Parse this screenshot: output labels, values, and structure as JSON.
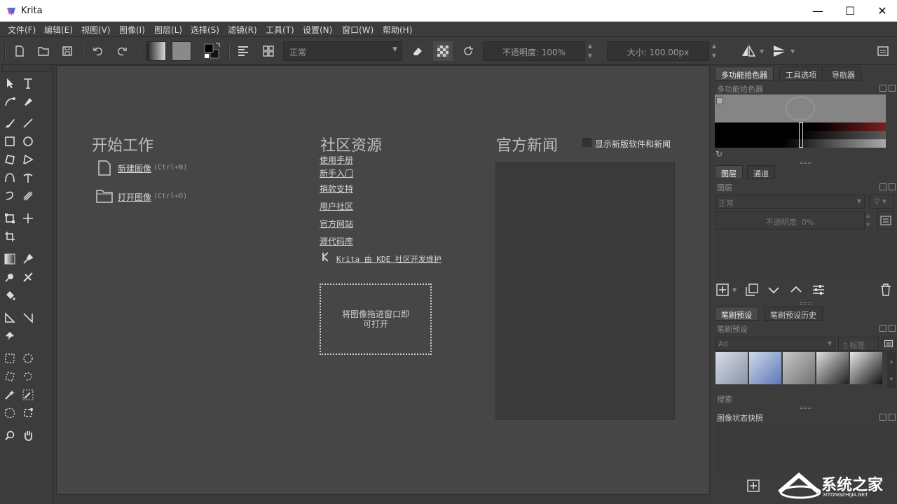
{
  "window": {
    "title": "Krita",
    "minimize": "—",
    "maximize": "☐",
    "close": "✕"
  },
  "menu": [
    "文件(F)",
    "编辑(E)",
    "视图(V)",
    "图像(I)",
    "图层(L)",
    "选择(S)",
    "滤镜(R)",
    "工具(T)",
    "设置(N)",
    "窗口(W)",
    "帮助(H)"
  ],
  "toolbar": {
    "blend_mode": "正常",
    "opacity": "不透明度: 100%",
    "size": "大小: 100.00px"
  },
  "welcome": {
    "start_heading": "开始工作",
    "new_image": "新建图像",
    "new_shortcut": "(Ctrl+N)",
    "open_image": "打开图像",
    "open_shortcut": "(Ctrl+O)",
    "community_heading": "社区资源",
    "links": [
      "使用手册",
      "新手入门",
      "捐款支持",
      "用户社区",
      "官方网站",
      "源代码库"
    ],
    "kde_text": "Krita 由 KDE 社区开发维护",
    "drop_text_line1": "将图像拖进窗口即",
    "drop_text_line2": "可打开",
    "news_heading": "官方新闻",
    "news_checkbox": "显示新版软件和新闻"
  },
  "dock": {
    "top_tabs": [
      "多功能拾色器",
      "工具选项",
      "导航器"
    ],
    "color_title": "多功能拾色器",
    "layer_tabs": [
      "图层",
      "通道"
    ],
    "layers_title": "图层",
    "layer_blend": "正常",
    "layer_opacity": "不透明度:  0%",
    "brush_tabs": [
      "笔刷预设",
      "笔刷预设历史"
    ],
    "brush_title": "笔刷预设",
    "brush_filter": "All",
    "brush_tag": "标签",
    "brush_search": "搜索",
    "snapshot_title": "图像状态快照"
  },
  "watermark": {
    "main": "系统之家",
    "sub": "XITONGZHIJIA.NET"
  }
}
